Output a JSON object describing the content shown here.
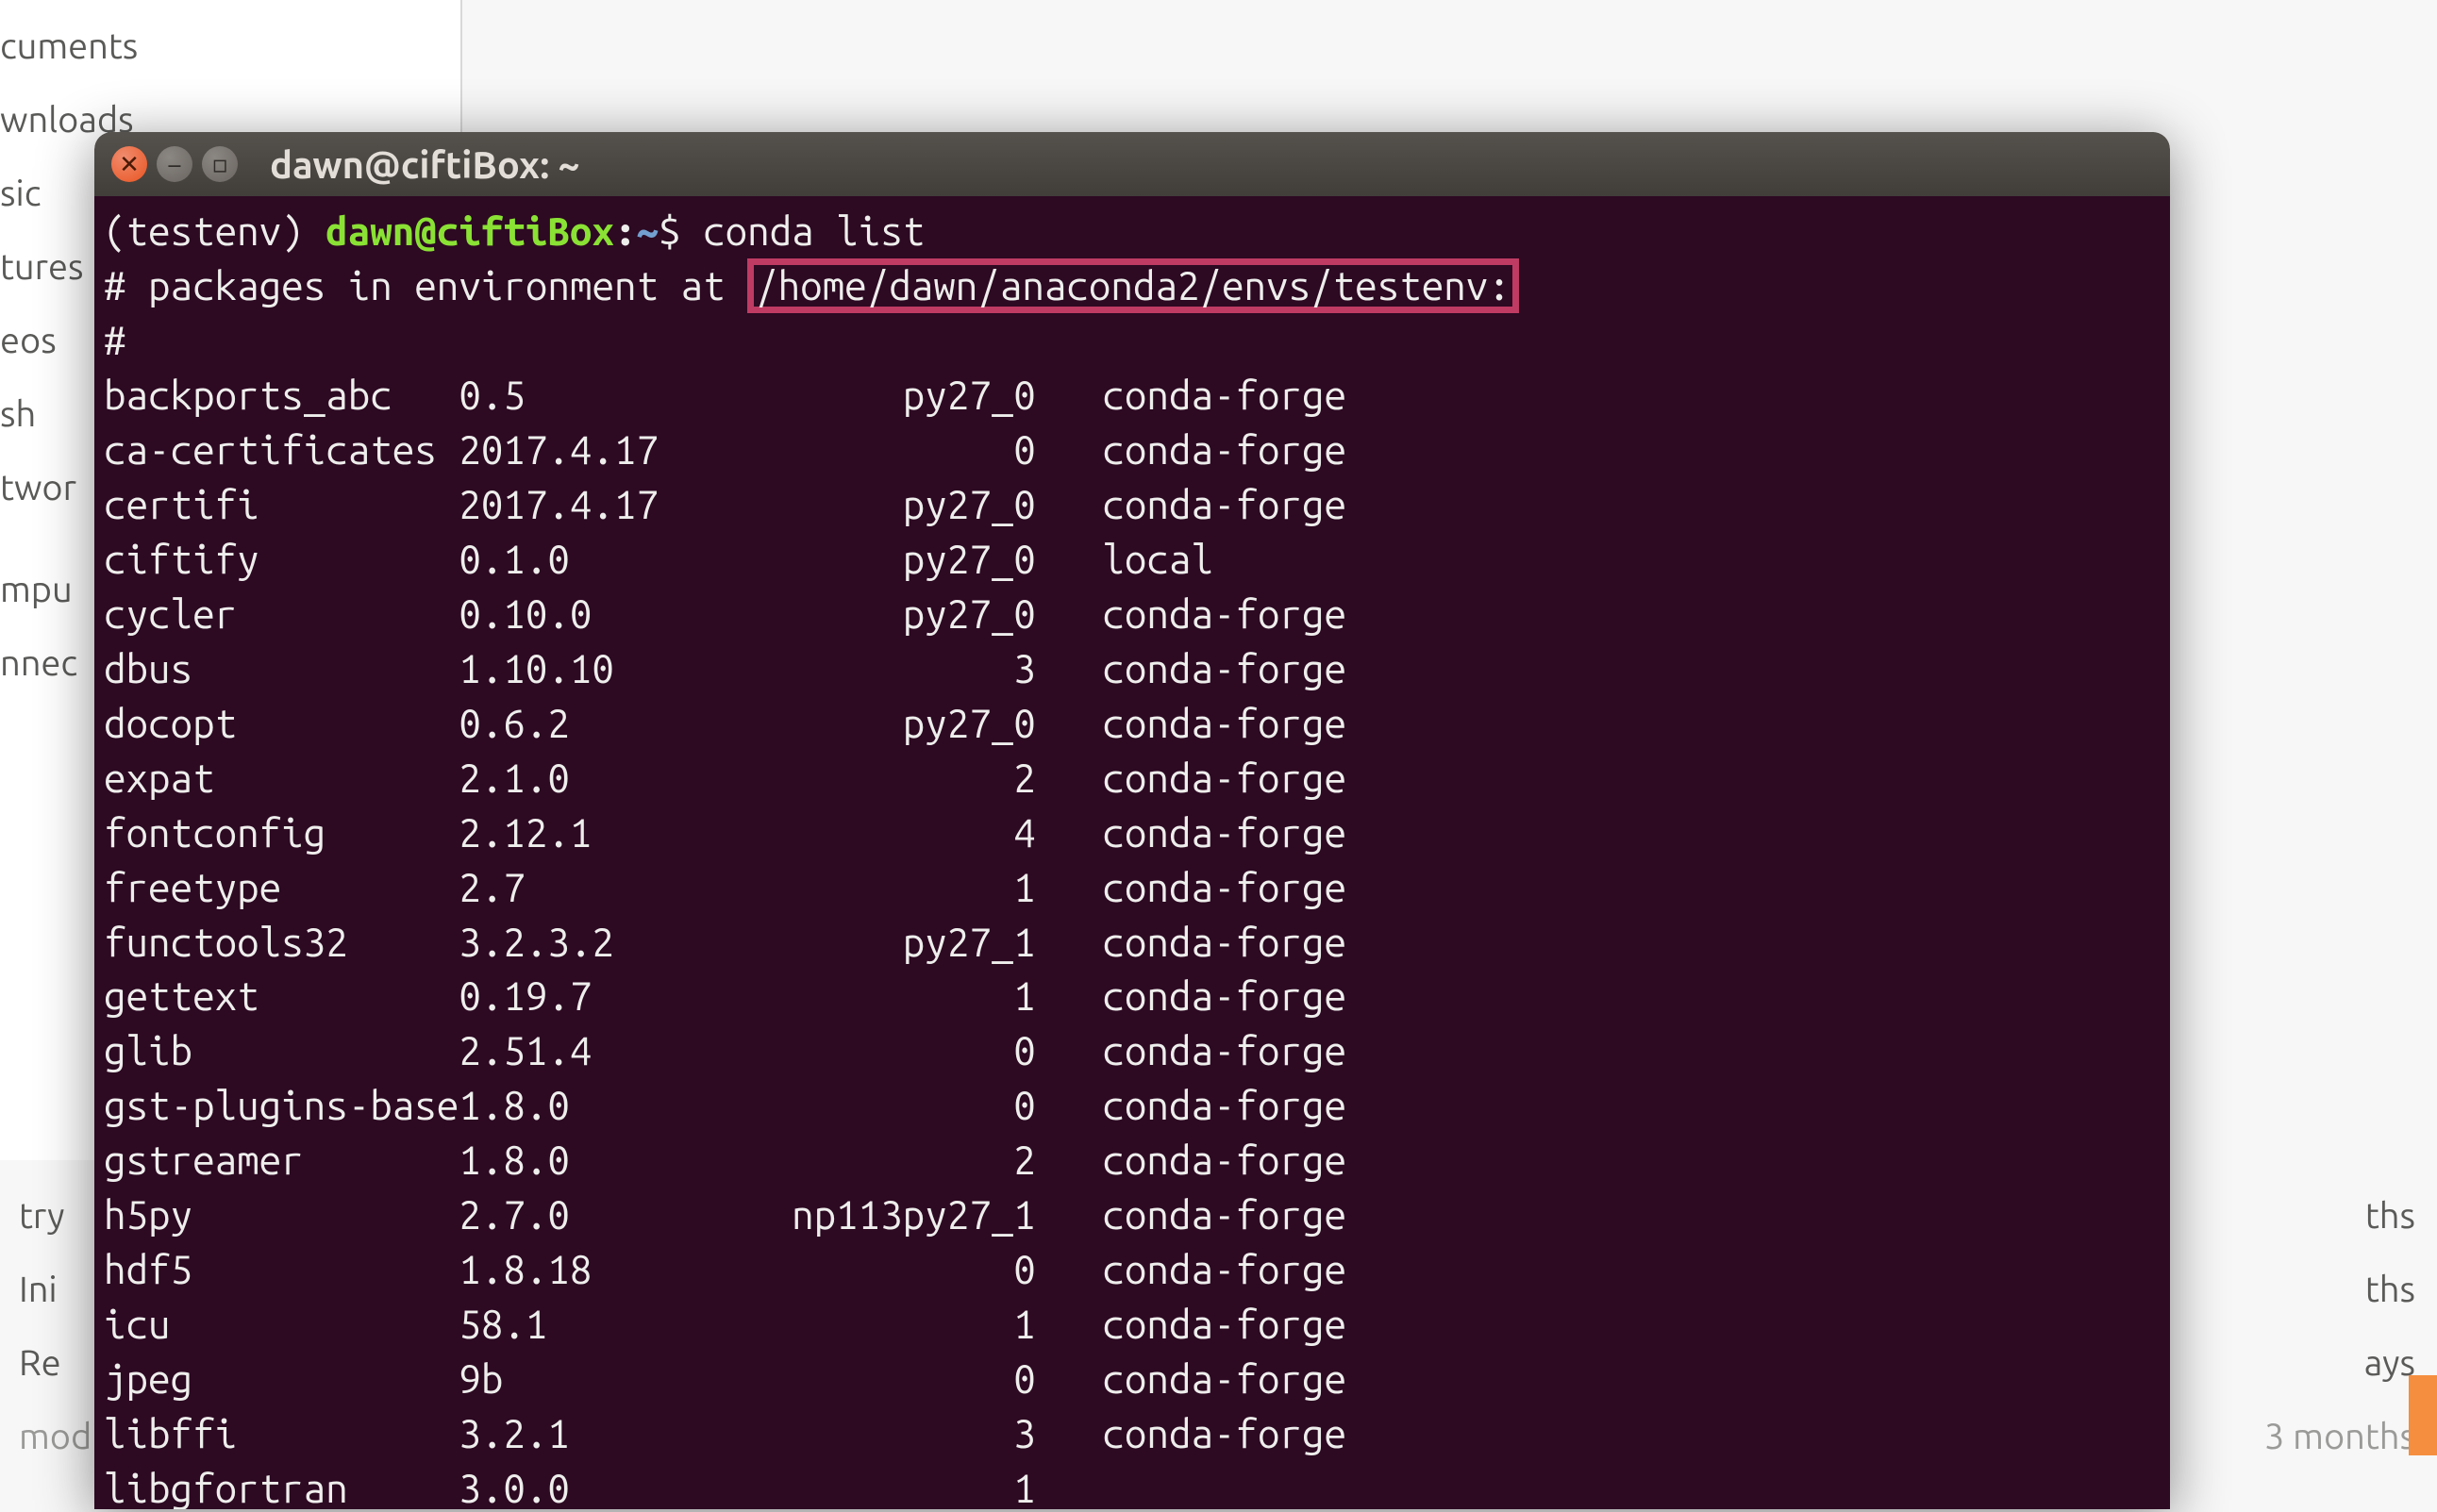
{
  "background_sidebar": {
    "items": [
      "cuments",
      "wnloads",
      "sic",
      "tures",
      "eos",
      "sh",
      "twor",
      "mpu",
      "nnec"
    ]
  },
  "background_rows": [
    {
      "left": "try",
      "right": "ths"
    },
    {
      "left": "Ini",
      "right": "ths"
    },
    {
      "left": "Re",
      "right": "ays"
    },
    {
      "left": "modified help docs to have underscores",
      "right": "3 months"
    }
  ],
  "window": {
    "title": "dawn@ciftiBox: ~",
    "close_glyph": "✕",
    "min_glyph": "–",
    "max_glyph": "▫"
  },
  "terminal": {
    "prompt": {
      "env": "(testenv) ",
      "userhost": "dawn@ciftiBox",
      "colon": ":",
      "path": "~",
      "dollar": "$",
      "command": " conda list"
    },
    "header_prefix": "# packages in environment at ",
    "header_path": "/home/dawn/anaconda2/envs/testenv:",
    "hash": "#",
    "packages": [
      {
        "name": "backports_abc",
        "version": "0.5",
        "build": "py27_0",
        "channel": "conda-forge"
      },
      {
        "name": "ca-certificates",
        "version": "2017.4.17",
        "build": "0",
        "channel": "conda-forge"
      },
      {
        "name": "certifi",
        "version": "2017.4.17",
        "build": "py27_0",
        "channel": "conda-forge"
      },
      {
        "name": "ciftify",
        "version": "0.1.0",
        "build": "py27_0",
        "channel": "local"
      },
      {
        "name": "cycler",
        "version": "0.10.0",
        "build": "py27_0",
        "channel": "conda-forge"
      },
      {
        "name": "dbus",
        "version": "1.10.10",
        "build": "3",
        "channel": "conda-forge"
      },
      {
        "name": "docopt",
        "version": "0.6.2",
        "build": "py27_0",
        "channel": "conda-forge"
      },
      {
        "name": "expat",
        "version": "2.1.0",
        "build": "2",
        "channel": "conda-forge"
      },
      {
        "name": "fontconfig",
        "version": "2.12.1",
        "build": "4",
        "channel": "conda-forge"
      },
      {
        "name": "freetype",
        "version": "2.7",
        "build": "1",
        "channel": "conda-forge"
      },
      {
        "name": "functools32",
        "version": "3.2.3.2",
        "build": "py27_1",
        "channel": "conda-forge"
      },
      {
        "name": "gettext",
        "version": "0.19.7",
        "build": "1",
        "channel": "conda-forge"
      },
      {
        "name": "glib",
        "version": "2.51.4",
        "build": "0",
        "channel": "conda-forge"
      },
      {
        "name": "gst-plugins-base",
        "version": "1.8.0",
        "build": "0",
        "channel": "conda-forge"
      },
      {
        "name": "gstreamer",
        "version": "1.8.0",
        "build": "2",
        "channel": "conda-forge"
      },
      {
        "name": "h5py",
        "version": "2.7.0",
        "build": "np113py27_1",
        "channel": "conda-forge"
      },
      {
        "name": "hdf5",
        "version": "1.8.18",
        "build": "0",
        "channel": "conda-forge"
      },
      {
        "name": "icu",
        "version": "58.1",
        "build": "1",
        "channel": "conda-forge"
      },
      {
        "name": "jpeg",
        "version": "9b",
        "build": "0",
        "channel": "conda-forge"
      },
      {
        "name": "libffi",
        "version": "3.2.1",
        "build": "3",
        "channel": "conda-forge"
      },
      {
        "name": "libgfortran",
        "version": "3.0.0",
        "build": "1",
        "channel": ""
      }
    ]
  }
}
